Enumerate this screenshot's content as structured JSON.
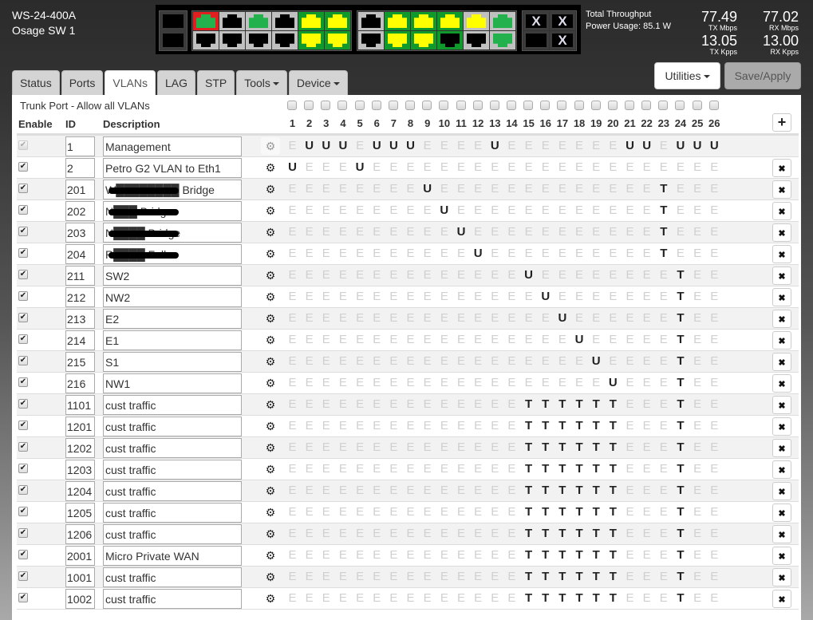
{
  "device": {
    "model": "WS-24-400A",
    "name": "Osage SW 1"
  },
  "port_panel": {
    "sfp_left": [
      {
        "id": "sfp-left-top",
        "bg": "sfp",
        "jack": "black"
      },
      {
        "id": "sfp-left-bottom",
        "bg": "sfp",
        "jack": "black"
      }
    ],
    "group1_top": [
      {
        "bg": "red",
        "jack": "green"
      },
      {
        "bg": "gray",
        "jack": "black"
      },
      {
        "bg": "gray",
        "jack": "green"
      },
      {
        "bg": "gray",
        "jack": "black"
      },
      {
        "bg": "green",
        "jack": "yellow"
      },
      {
        "bg": "green",
        "jack": "yellow"
      }
    ],
    "group1_bottom": [
      {
        "bg": "gray",
        "jack": "black"
      },
      {
        "bg": "gray",
        "jack": "black"
      },
      {
        "bg": "gray",
        "jack": "black"
      },
      {
        "bg": "gray",
        "jack": "black"
      },
      {
        "bg": "green",
        "jack": "yellow"
      },
      {
        "bg": "green",
        "jack": "yellow"
      }
    ],
    "group2_top": [
      {
        "bg": "gray",
        "jack": "black"
      },
      {
        "bg": "green",
        "jack": "yellow"
      },
      {
        "bg": "green",
        "jack": "yellow"
      },
      {
        "bg": "green",
        "jack": "yellow"
      },
      {
        "bg": "gray",
        "jack": "yellow"
      },
      {
        "bg": "gray",
        "jack": "green"
      }
    ],
    "group2_bottom": [
      {
        "bg": "gray",
        "jack": "black"
      },
      {
        "bg": "green",
        "jack": "yellow"
      },
      {
        "bg": "green",
        "jack": "yellow"
      },
      {
        "bg": "green",
        "jack": "black"
      },
      {
        "bg": "gray",
        "jack": "black"
      },
      {
        "bg": "gray",
        "jack": "green"
      }
    ],
    "sfp_right": [
      {
        "bg": "sfp",
        "jack": "black",
        "mark": "X"
      },
      {
        "bg": "sfp",
        "jack": "black",
        "mark": "X"
      },
      {
        "bg": "sfp",
        "jack": "black",
        "mark": ""
      },
      {
        "bg": "sfp",
        "jack": "black",
        "mark": "X"
      }
    ],
    "colors": {
      "link_green": "#22b14c",
      "poe_yellow": "#ffff00",
      "active_bg": "#0f9a2b",
      "alert_red": "#e02020"
    }
  },
  "stats": {
    "throughput_label": "Total Throughput",
    "power_label": "Power Usage: 85.1 W",
    "tx_mbps": "77.49",
    "tx_mbps_unit": "TX Mbps",
    "rx_mbps": "77.02",
    "rx_mbps_unit": "RX Mbps",
    "tx_kpps": "13.05",
    "tx_kpps_unit": "TX Kpps",
    "rx_kpps": "13.00",
    "rx_kpps_unit": "RX Kpps"
  },
  "tabs": [
    {
      "label": "Status",
      "active": false,
      "dropdown": false
    },
    {
      "label": "Ports",
      "active": false,
      "dropdown": false
    },
    {
      "label": "VLANs",
      "active": true,
      "dropdown": false
    },
    {
      "label": "LAG",
      "active": false,
      "dropdown": false
    },
    {
      "label": "STP",
      "active": false,
      "dropdown": false
    },
    {
      "label": "Tools",
      "active": false,
      "dropdown": true
    },
    {
      "label": "Device",
      "active": false,
      "dropdown": true
    }
  ],
  "toolbar": {
    "utilities_label": "Utilities",
    "save_label": "Save/Apply"
  },
  "vlan_table": {
    "trunk_label": "Trunk Port - Allow all VLANs",
    "headers": {
      "enable": "Enable",
      "id": "ID",
      "description": "Description"
    },
    "ports": [
      "1",
      "2",
      "3",
      "4",
      "5",
      "6",
      "7",
      "8",
      "9",
      "10",
      "11",
      "12",
      "13",
      "14",
      "15",
      "16",
      "17",
      "18",
      "19",
      "20",
      "21",
      "22",
      "23",
      "24",
      "25",
      "26"
    ],
    "add_icon": "plus-icon",
    "rows": [
      {
        "enabled": true,
        "locked": true,
        "id": "1",
        "description": "Management",
        "modes": "EUUUEUUUEEEEUEEEEEEEUUEUUU"
      },
      {
        "enabled": true,
        "locked": false,
        "id": "2",
        "description": "Petro G2 VLAN to Eth1",
        "modes": "UEEEUEEEEEEEEEEEEEEEEEEEEE"
      },
      {
        "enabled": true,
        "locked": false,
        "id": "201",
        "description": "W████████ Bridge",
        "modes": "EEEEEEEEUEEEEEEEEEEEEETEEE",
        "redacted": true
      },
      {
        "enabled": true,
        "locked": false,
        "id": "202",
        "description": "N███ Bridge",
        "modes": "EEEEEEEEEUEEEEEEEEEEEETEEE",
        "redacted": true
      },
      {
        "enabled": true,
        "locked": false,
        "id": "203",
        "description": "N████ Bridge",
        "modes": "EEEEEEEEEEUEEEEEEEEEEETEEE",
        "redacted": true
      },
      {
        "enabled": true,
        "locked": false,
        "id": "204",
        "description": "R████ Falls",
        "modes": "EEEEEEEEEEEUEEEEEEEEEETEEE",
        "redacted": true
      },
      {
        "enabled": true,
        "locked": false,
        "id": "211",
        "description": "SW2",
        "modes": "EEEEEEEEEEEEEEUEEEEEEEETEE"
      },
      {
        "enabled": true,
        "locked": false,
        "id": "212",
        "description": "NW2",
        "modes": "EEEEEEEEEEEEEEEUEEEEEEETEE"
      },
      {
        "enabled": true,
        "locked": false,
        "id": "213",
        "description": "E2",
        "modes": "EEEEEEEEEEEEEEEEUEEEEEETEE"
      },
      {
        "enabled": true,
        "locked": false,
        "id": "214",
        "description": "E1",
        "modes": "EEEEEEEEEEEEEEEEEUEEEEETEE"
      },
      {
        "enabled": true,
        "locked": false,
        "id": "215",
        "description": "S1",
        "modes": "EEEEEEEEEEEEEEEEEEUEEEETEE"
      },
      {
        "enabled": true,
        "locked": false,
        "id": "216",
        "description": "NW1",
        "modes": "EEEEEEEEEEEEEEEEEEEUEEETEE"
      },
      {
        "enabled": true,
        "locked": false,
        "id": "1101",
        "description": "cust traffic",
        "modes": "EEEEEEEEEEEEEETTTTTTEEETEE"
      },
      {
        "enabled": true,
        "locked": false,
        "id": "1201",
        "description": "cust traffic",
        "modes": "EEEEEEEEEEEEEETTTTTTEEETEE"
      },
      {
        "enabled": true,
        "locked": false,
        "id": "1202",
        "description": "cust traffic",
        "modes": "EEEEEEEEEEEEEETTTTTTEEETEE"
      },
      {
        "enabled": true,
        "locked": false,
        "id": "1203",
        "description": "cust traffic",
        "modes": "EEEEEEEEEEEEEETTTTTTEEETEE"
      },
      {
        "enabled": true,
        "locked": false,
        "id": "1204",
        "description": "cust traffic",
        "modes": "EEEEEEEEEEEEEETTTTTTEEETEE"
      },
      {
        "enabled": true,
        "locked": false,
        "id": "1205",
        "description": "cust traffic",
        "modes": "EEEEEEEEEEEEEETTTTTTEEETEE"
      },
      {
        "enabled": true,
        "locked": false,
        "id": "1206",
        "description": "cust traffic",
        "modes": "EEEEEEEEEEEEEETTTTTTEEETEE"
      },
      {
        "enabled": true,
        "locked": false,
        "id": "2001",
        "description": "Micro Private WAN",
        "modes": "EEEEEEEEEEEEEETTTTTTEEETEE"
      },
      {
        "enabled": true,
        "locked": false,
        "id": "1001",
        "description": "cust traffic",
        "modes": "EEEEEEEEEEEEEETTTTTTEEETEE"
      },
      {
        "enabled": true,
        "locked": false,
        "id": "1002",
        "description": "cust traffic",
        "modes": "EEEEEEEEEEEEEETTTTTTEEETEE"
      }
    ]
  }
}
